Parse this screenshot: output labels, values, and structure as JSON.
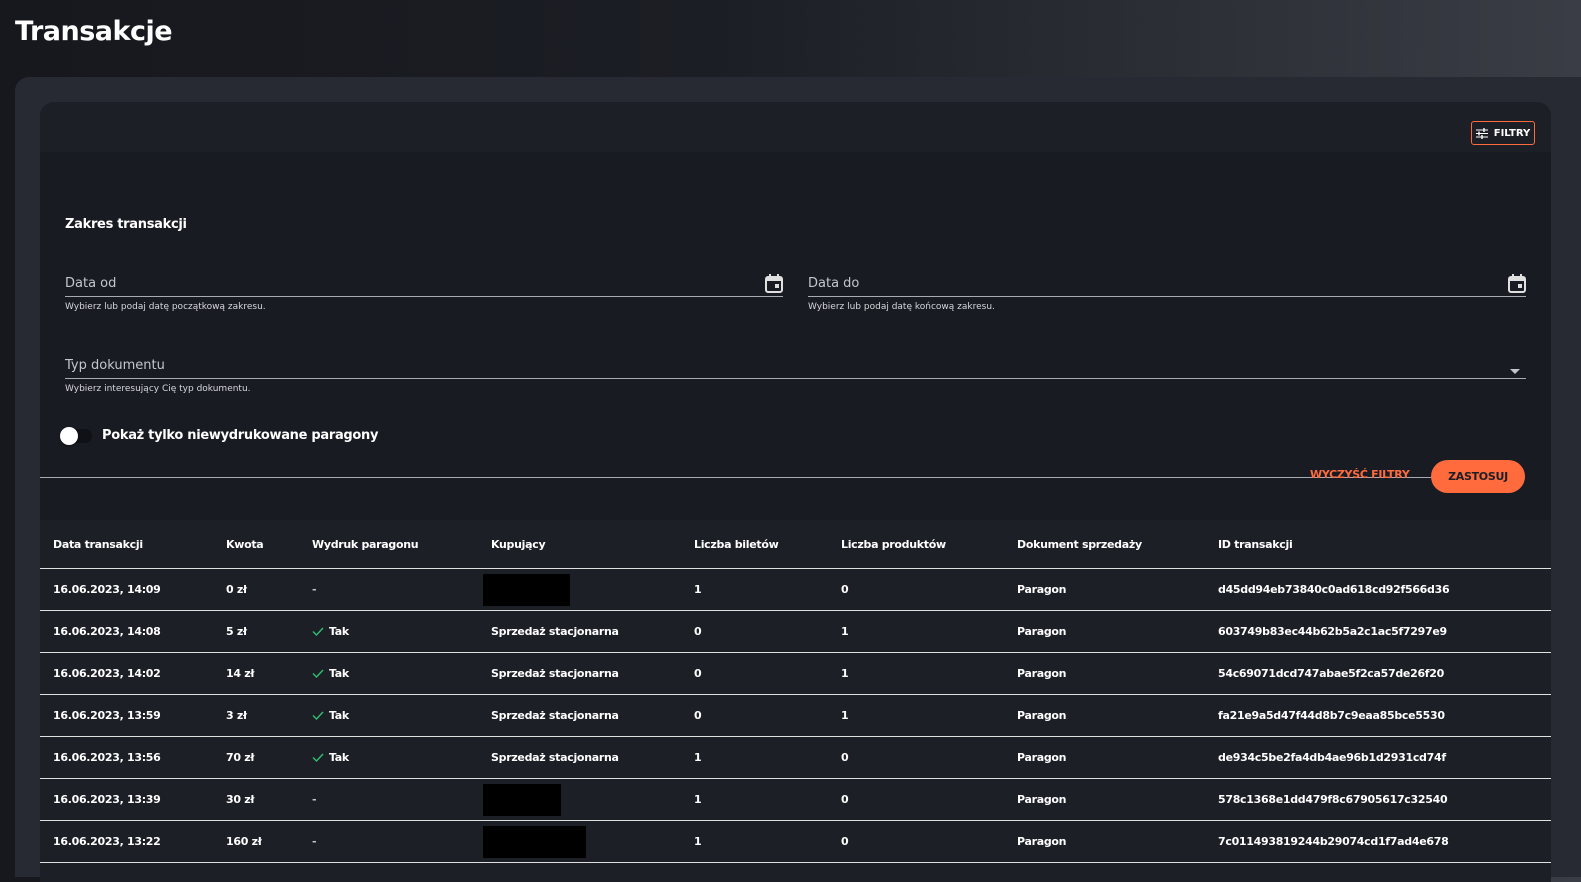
{
  "page_title": "Transakcje",
  "filters": {
    "toggle_button_label": "FILTRY",
    "section_label": "Zakres transakcji",
    "date_from": {
      "label": "Data od",
      "hint": "Wybierz lub podaj datę początkową zakresu."
    },
    "date_to": {
      "label": "Data do",
      "hint": "Wybierz lub podaj datę końcową zakresu."
    },
    "document_type": {
      "label": "Typ dokumentu",
      "hint": "Wybierz interesujący Cię typ dokumentu."
    },
    "unprinted_only": {
      "label": "Pokaż tylko niewydrukowane paragony",
      "checked": false
    },
    "clear_label": "WYCZYŚĆ FILTRY",
    "apply_label": "ZASTOSUJ"
  },
  "colors": {
    "accent": "#ff6b3d",
    "card": "#1d1f27",
    "panel": "#191b22",
    "check": "#2fbf71"
  },
  "table": {
    "columns": [
      "Data transakcji",
      "Kwota",
      "Wydruk paragonu",
      "Kupujący",
      "Liczba biletów",
      "Liczba produktów",
      "Dokument sprzedaży",
      "ID transakcji"
    ],
    "rows": [
      {
        "date": "16.06.2023, 14:09",
        "amount": "0 zł",
        "printed": "-",
        "buyer": "",
        "tickets": "1",
        "products": "0",
        "document": "Paragon",
        "id": "d45dd94eb73840c0ad618cd92f566d36"
      },
      {
        "date": "16.06.2023, 14:08",
        "amount": "5 zł",
        "printed": "Tak",
        "buyer": "Sprzedaż stacjonarna",
        "tickets": "0",
        "products": "1",
        "document": "Paragon",
        "id": "603749b83ec44b62b5a2c1ac5f7297e9"
      },
      {
        "date": "16.06.2023, 14:02",
        "amount": "14 zł",
        "printed": "Tak",
        "buyer": "Sprzedaż stacjonarna",
        "tickets": "0",
        "products": "1",
        "document": "Paragon",
        "id": "54c69071dcd747abae5f2ca57de26f20"
      },
      {
        "date": "16.06.2023, 13:59",
        "amount": "3 zł",
        "printed": "Tak",
        "buyer": "Sprzedaż stacjonarna",
        "tickets": "0",
        "products": "1",
        "document": "Paragon",
        "id": "fa21e9a5d47f44d8b7c9eaa85bce5530"
      },
      {
        "date": "16.06.2023, 13:56",
        "amount": "70 zł",
        "printed": "Tak",
        "buyer": "Sprzedaż stacjonarna",
        "tickets": "1",
        "products": "0",
        "document": "Paragon",
        "id": "de934c5be2fa4db4ae96b1d2931cd74f"
      },
      {
        "date": "16.06.2023, 13:39",
        "amount": "30 zł",
        "printed": "-",
        "buyer": "",
        "tickets": "1",
        "products": "0",
        "document": "Paragon",
        "id": "578c1368e1dd479f8c67905617c32540"
      },
      {
        "date": "16.06.2023, 13:22",
        "amount": "160 zł",
        "printed": "-",
        "buyer": "",
        "tickets": "1",
        "products": "0",
        "document": "Paragon",
        "id": "7c011493819244b29074cd1f7ad4e678"
      }
    ]
  }
}
